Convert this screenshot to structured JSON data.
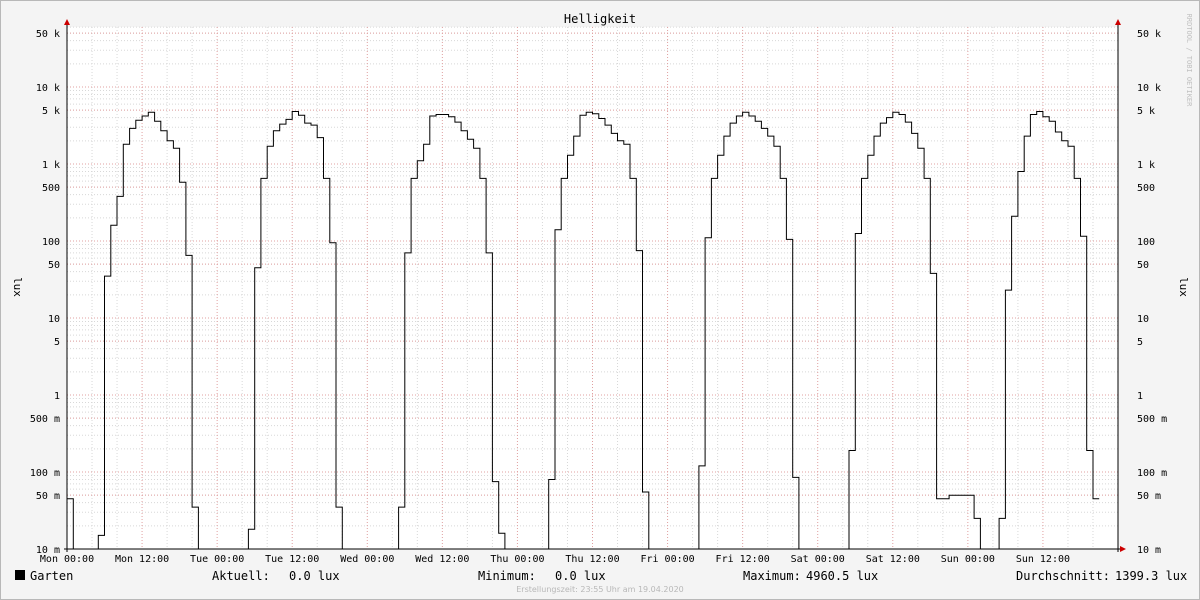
{
  "chart_data": {
    "type": "line",
    "title": "Helligkeit",
    "ylabel": "lux",
    "y_scale": "log",
    "ylim": [
      "10 m",
      "50 k"
    ],
    "y_ticks": [
      "10 m",
      "50 m",
      "100 m",
      "500 m",
      "1",
      "5",
      "10",
      "50",
      "100",
      "500",
      "1 k",
      "5 k",
      "10 k",
      "50 k"
    ],
    "x_ticks": [
      "Mon 00:00",
      "Mon 12:00",
      "Tue 00:00",
      "Tue 12:00",
      "Wed 00:00",
      "Wed 12:00",
      "Thu 00:00",
      "Thu 12:00",
      "Fri 00:00",
      "Fri 12:00",
      "Sat 00:00",
      "Sat 12:00",
      "Sun 00:00",
      "Sun 12:00"
    ],
    "x_unit": "hours since Mon 00:00",
    "series": [
      {
        "name": "Garten",
        "color": "#000000",
        "points": [
          [
            -0.1,
            0.045
          ],
          [
            0.5,
            0.045
          ],
          [
            0.5,
            0.01
          ],
          [
            2.5,
            0.01
          ],
          [
            2.5,
            0.015
          ],
          [
            3.0,
            0.015
          ],
          [
            3.0,
            35
          ],
          [
            3.5,
            35
          ],
          [
            3.5,
            160
          ],
          [
            4.0,
            160
          ],
          [
            4.0,
            380
          ],
          [
            4.5,
            380
          ],
          [
            4.5,
            1800
          ],
          [
            5.0,
            1800
          ],
          [
            5.0,
            2900
          ],
          [
            5.5,
            2900
          ],
          [
            5.5,
            3700
          ],
          [
            6.0,
            3700
          ],
          [
            6.0,
            4200
          ],
          [
            6.5,
            4200
          ],
          [
            6.5,
            4700
          ],
          [
            7.0,
            4700
          ],
          [
            7.0,
            3600
          ],
          [
            7.5,
            3600
          ],
          [
            7.5,
            2700
          ],
          [
            8.0,
            2700
          ],
          [
            8.0,
            2000
          ],
          [
            8.5,
            2000
          ],
          [
            8.5,
            1600
          ],
          [
            9.0,
            1600
          ],
          [
            9.0,
            580
          ],
          [
            9.5,
            580
          ],
          [
            9.5,
            65
          ],
          [
            10.0,
            65
          ],
          [
            10.0,
            0.035
          ],
          [
            10.5,
            0.035
          ],
          [
            10.5,
            0.01
          ],
          [
            14.5,
            0.01
          ],
          [
            14.5,
            0.018
          ],
          [
            15.0,
            0.018
          ],
          [
            15.0,
            45
          ],
          [
            15.5,
            45
          ],
          [
            15.5,
            650
          ],
          [
            16.0,
            650
          ],
          [
            16.0,
            1700
          ],
          [
            16.5,
            1700
          ],
          [
            16.5,
            2700
          ],
          [
            17.0,
            2700
          ],
          [
            17.0,
            3300
          ],
          [
            17.5,
            3300
          ],
          [
            17.5,
            3800
          ],
          [
            18.0,
            3800
          ],
          [
            18.0,
            4800
          ],
          [
            18.5,
            4800
          ],
          [
            18.5,
            4300
          ],
          [
            19.0,
            4300
          ],
          [
            19.0,
            3400
          ],
          [
            19.5,
            3400
          ],
          [
            19.5,
            3200
          ],
          [
            20.0,
            3200
          ],
          [
            20.0,
            2200
          ],
          [
            20.5,
            2200
          ],
          [
            20.5,
            650
          ],
          [
            21.0,
            650
          ],
          [
            21.0,
            95
          ],
          [
            21.5,
            95
          ],
          [
            21.5,
            0.035
          ],
          [
            22.0,
            0.035
          ],
          [
            22.0,
            0.01
          ],
          [
            26.5,
            0.01
          ],
          [
            26.5,
            0.035
          ],
          [
            27.0,
            0.035
          ],
          [
            27.0,
            70
          ],
          [
            27.5,
            70
          ],
          [
            27.5,
            650
          ],
          [
            28.0,
            650
          ],
          [
            28.0,
            1100
          ],
          [
            28.5,
            1100
          ],
          [
            28.5,
            1800
          ],
          [
            29.0,
            1800
          ],
          [
            29.0,
            4200
          ],
          [
            29.5,
            4200
          ],
          [
            29.5,
            4400
          ],
          [
            30.5,
            4400
          ],
          [
            30.5,
            4100
          ],
          [
            31.0,
            4100
          ],
          [
            31.0,
            3500
          ],
          [
            31.5,
            3500
          ],
          [
            31.5,
            2700
          ],
          [
            32.0,
            2700
          ],
          [
            32.0,
            2100
          ],
          [
            32.5,
            2100
          ],
          [
            32.5,
            1600
          ],
          [
            33.0,
            1600
          ],
          [
            33.0,
            650
          ],
          [
            33.5,
            650
          ],
          [
            33.5,
            70
          ],
          [
            34.0,
            70
          ],
          [
            34.0,
            0.075
          ],
          [
            34.5,
            0.075
          ],
          [
            34.5,
            0.016
          ],
          [
            35.0,
            0.016
          ],
          [
            35.0,
            0.01
          ],
          [
            38.5,
            0.01
          ],
          [
            38.5,
            0.08
          ],
          [
            39.0,
            0.08
          ],
          [
            39.0,
            140
          ],
          [
            39.5,
            140
          ],
          [
            39.5,
            650
          ],
          [
            40.0,
            650
          ],
          [
            40.0,
            1300
          ],
          [
            40.5,
            1300
          ],
          [
            40.5,
            2300
          ],
          [
            41.0,
            2300
          ],
          [
            41.0,
            4300
          ],
          [
            41.5,
            4300
          ],
          [
            41.5,
            4700
          ],
          [
            42.0,
            4700
          ],
          [
            42.0,
            4500
          ],
          [
            42.5,
            4500
          ],
          [
            42.5,
            3900
          ],
          [
            43.0,
            3900
          ],
          [
            43.0,
            3200
          ],
          [
            43.5,
            3200
          ],
          [
            43.5,
            2500
          ],
          [
            44.0,
            2500
          ],
          [
            44.0,
            2000
          ],
          [
            44.5,
            2000
          ],
          [
            44.5,
            1800
          ],
          [
            45.0,
            1800
          ],
          [
            45.0,
            650
          ],
          [
            45.5,
            650
          ],
          [
            45.5,
            75
          ],
          [
            46.0,
            75
          ],
          [
            46.0,
            0.055
          ],
          [
            46.5,
            0.055
          ],
          [
            46.5,
            0.01
          ],
          [
            50.5,
            0.01
          ],
          [
            50.5,
            0.12
          ],
          [
            51.0,
            0.12
          ],
          [
            51.0,
            110
          ],
          [
            51.5,
            110
          ],
          [
            51.5,
            650
          ],
          [
            52.0,
            650
          ],
          [
            52.0,
            1300
          ],
          [
            52.5,
            1300
          ],
          [
            52.5,
            2300
          ],
          [
            53.0,
            2300
          ],
          [
            53.0,
            3400
          ],
          [
            53.5,
            3400
          ],
          [
            53.5,
            4200
          ],
          [
            54.0,
            4200
          ],
          [
            54.0,
            4700
          ],
          [
            54.5,
            4700
          ],
          [
            54.5,
            4200
          ],
          [
            55.0,
            4200
          ],
          [
            55.0,
            3600
          ],
          [
            55.5,
            3600
          ],
          [
            55.5,
            2900
          ],
          [
            56.0,
            2900
          ],
          [
            56.0,
            2300
          ],
          [
            56.5,
            2300
          ],
          [
            56.5,
            1700
          ],
          [
            57.0,
            1700
          ],
          [
            57.0,
            650
          ],
          [
            57.5,
            650
          ],
          [
            57.5,
            105
          ],
          [
            58.0,
            105
          ],
          [
            58.0,
            0.085
          ],
          [
            58.5,
            0.085
          ],
          [
            58.5,
            0.01
          ],
          [
            62.5,
            0.01
          ],
          [
            62.5,
            0.19
          ],
          [
            63.0,
            0.19
          ],
          [
            63.0,
            125
          ],
          [
            63.5,
            125
          ],
          [
            63.5,
            650
          ],
          [
            64.0,
            650
          ],
          [
            64.0,
            1300
          ],
          [
            64.5,
            1300
          ],
          [
            64.5,
            2300
          ],
          [
            65.0,
            2300
          ],
          [
            65.0,
            3400
          ],
          [
            65.5,
            3400
          ],
          [
            65.5,
            4000
          ],
          [
            66.0,
            4000
          ],
          [
            66.0,
            4700
          ],
          [
            66.5,
            4700
          ],
          [
            66.5,
            4400
          ],
          [
            67.0,
            4400
          ],
          [
            67.0,
            3500
          ],
          [
            67.5,
            3500
          ],
          [
            67.5,
            2500
          ],
          [
            68.0,
            2500
          ],
          [
            68.0,
            1600
          ],
          [
            68.5,
            1600
          ],
          [
            68.5,
            650
          ],
          [
            69.0,
            650
          ],
          [
            69.0,
            38
          ],
          [
            69.5,
            38
          ],
          [
            69.5,
            0.045
          ],
          [
            70.5,
            0.045
          ],
          [
            70.5,
            0.05
          ],
          [
            72.5,
            0.05
          ],
          [
            72.5,
            0.025
          ],
          [
            73.0,
            0.025
          ],
          [
            73.0,
            0.01
          ],
          [
            74.5,
            0.01
          ],
          [
            74.5,
            0.025
          ],
          [
            75.0,
            0.025
          ],
          [
            75.0,
            23
          ],
          [
            75.5,
            23
          ],
          [
            75.5,
            210
          ],
          [
            76.0,
            210
          ],
          [
            76.0,
            800
          ],
          [
            76.5,
            800
          ],
          [
            76.5,
            2300
          ],
          [
            77.0,
            2300
          ],
          [
            77.0,
            4400
          ],
          [
            77.5,
            4400
          ],
          [
            77.5,
            4800
          ],
          [
            78.0,
            4800
          ],
          [
            78.0,
            4100
          ],
          [
            78.5,
            4100
          ],
          [
            78.5,
            3600
          ],
          [
            79.0,
            3600
          ],
          [
            79.0,
            2600
          ],
          [
            79.5,
            2600
          ],
          [
            79.5,
            2000
          ],
          [
            80.0,
            2000
          ],
          [
            80.0,
            1700
          ],
          [
            80.5,
            1700
          ],
          [
            80.5,
            650
          ],
          [
            81.0,
            650
          ],
          [
            81.0,
            115
          ],
          [
            81.5,
            115
          ],
          [
            81.5,
            0.19
          ],
          [
            82.0,
            0.19
          ],
          [
            82.0,
            0.045
          ],
          [
            82.5,
            0.045
          ]
        ]
      }
    ],
    "grid": true,
    "colors": {
      "canvas": "#ffffff",
      "background": "#f4f4f4",
      "grid_major": "#e0a0a0",
      "grid_minor": "#d8d8d8",
      "arrow": "#cc0000",
      "line": "#000000"
    }
  },
  "watermark": "RRDTOOL / TOBI OETIKER",
  "legend": {
    "series_name": "Garten",
    "current_label": "Aktuell:",
    "current_value": "0.0 lux",
    "min_label": "Minimum:",
    "min_value": "0.0 lux",
    "max_label": "Maximum:",
    "max_value": "4960.5 lux",
    "avg_label": "Durchschnitt:",
    "avg_value": "1399.3 lux"
  },
  "footer": "Erstellungszeit: 23:55 Uhr am 19.04.2020"
}
